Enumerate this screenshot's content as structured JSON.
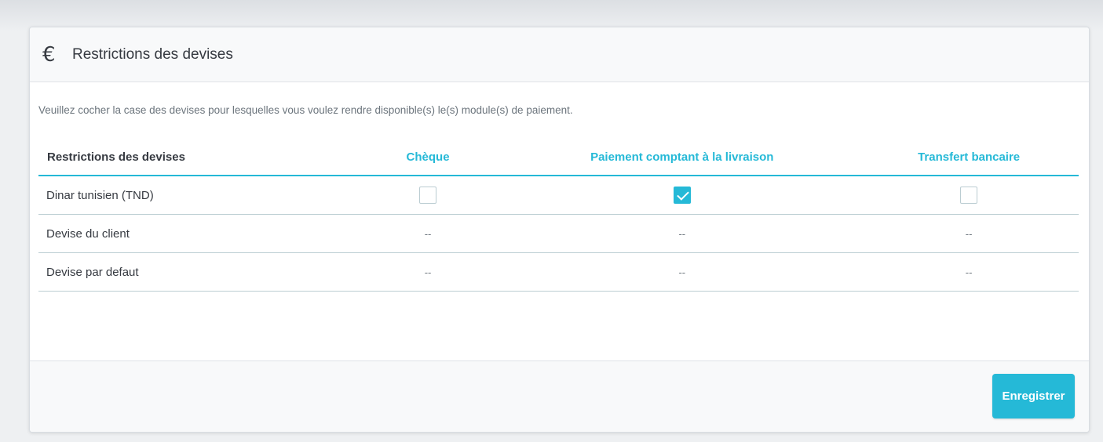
{
  "panel": {
    "icon": "euro-icon",
    "icon_glyph": "€",
    "title": "Restrictions des devises",
    "description": "Veuillez cocher la case des devises pour lesquelles vous voulez rendre disponible(s) le(s) module(s) de paiement."
  },
  "table": {
    "headers": [
      "Restrictions des devises",
      "Chèque",
      "Paiement comptant à la livraison",
      "Transfert bancaire"
    ],
    "rows": [
      {
        "label": "Dinar tunisien (TND)",
        "cheque": false,
        "cod": true,
        "bank": false
      },
      {
        "label": "Devise du client",
        "cheque": "--",
        "cod": "--",
        "bank": "--"
      },
      {
        "label": "Devise par defaut",
        "cheque": "--",
        "cod": "--",
        "bank": "--"
      }
    ]
  },
  "footer": {
    "save_label": "Enregistrer"
  },
  "colors": {
    "accent": "#25b9d7",
    "text": "#363a41",
    "muted": "#6c757d"
  }
}
